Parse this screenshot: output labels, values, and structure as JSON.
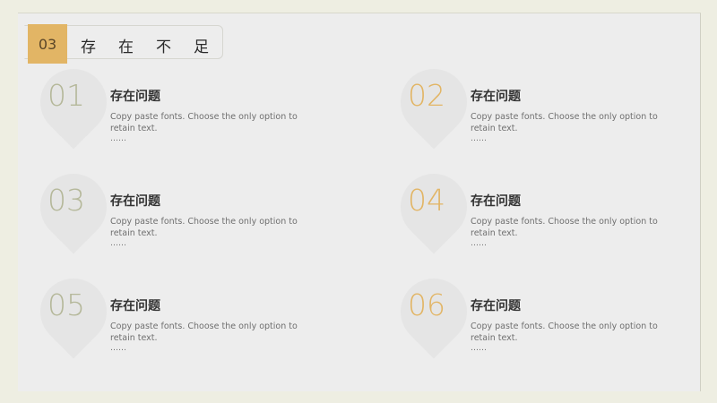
{
  "header": {
    "section_number": "03",
    "section_title": "存在不足"
  },
  "items": [
    {
      "number": "01",
      "title": "存在问题",
      "desc": "Copy paste fonts. Choose the only option to retain text.",
      "dots": "……"
    },
    {
      "number": "02",
      "title": "存在问题",
      "desc": "Copy paste fonts. Choose the only option to retain text.",
      "dots": "……"
    },
    {
      "number": "03",
      "title": "存在问题",
      "desc": "Copy paste fonts. Choose the only option to retain text.",
      "dots": "……"
    },
    {
      "number": "04",
      "title": "存在问题",
      "desc": "Copy paste fonts. Choose the only option to retain text.",
      "dots": "……"
    },
    {
      "number": "05",
      "title": "存在问题",
      "desc": "Copy paste fonts. Choose the only option to retain text.",
      "dots": "……"
    },
    {
      "number": "06",
      "title": "存在问题",
      "desc": "Copy paste fonts. Choose the only option to retain text.",
      "dots": "……"
    }
  ],
  "colors": {
    "accent_gold": "#e2b565",
    "accent_green": "#b5b89a",
    "background": "#eeeee2",
    "slide": "#ededed"
  }
}
